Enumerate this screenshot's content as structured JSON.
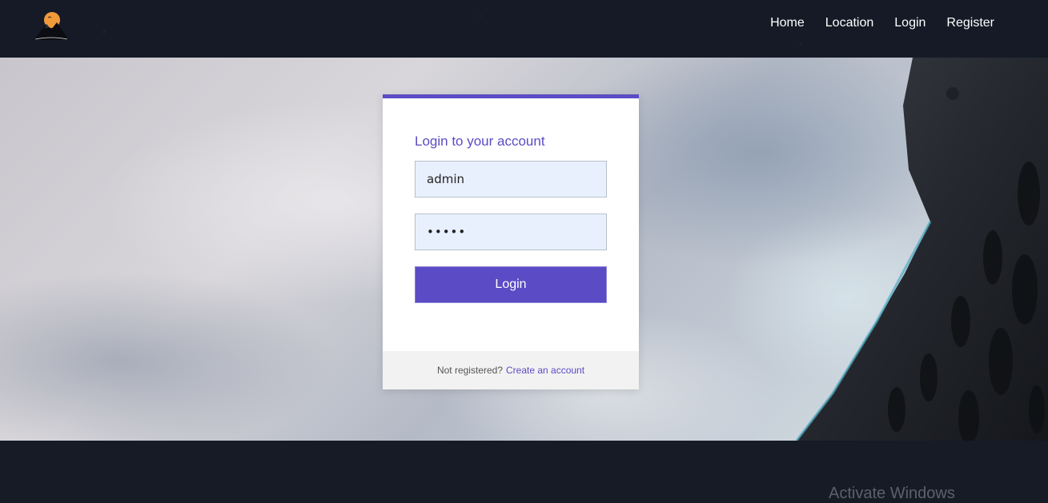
{
  "header": {
    "logo_icon": "mountain-sun-logo",
    "nav": [
      {
        "label": "Home"
      },
      {
        "label": "Location"
      },
      {
        "label": "Login"
      },
      {
        "label": "Register"
      }
    ]
  },
  "login": {
    "title": "Login to your account",
    "username_value": "admin",
    "password_value": "admin",
    "submit_label": "Login",
    "footer_text": "Not registered?",
    "footer_link": "Create an account"
  },
  "watermark": {
    "text": "Activate Windows"
  },
  "colors": {
    "accent": "#5b4bc5",
    "header_bg": "#151a26",
    "input_bg": "#e8f0fe"
  }
}
